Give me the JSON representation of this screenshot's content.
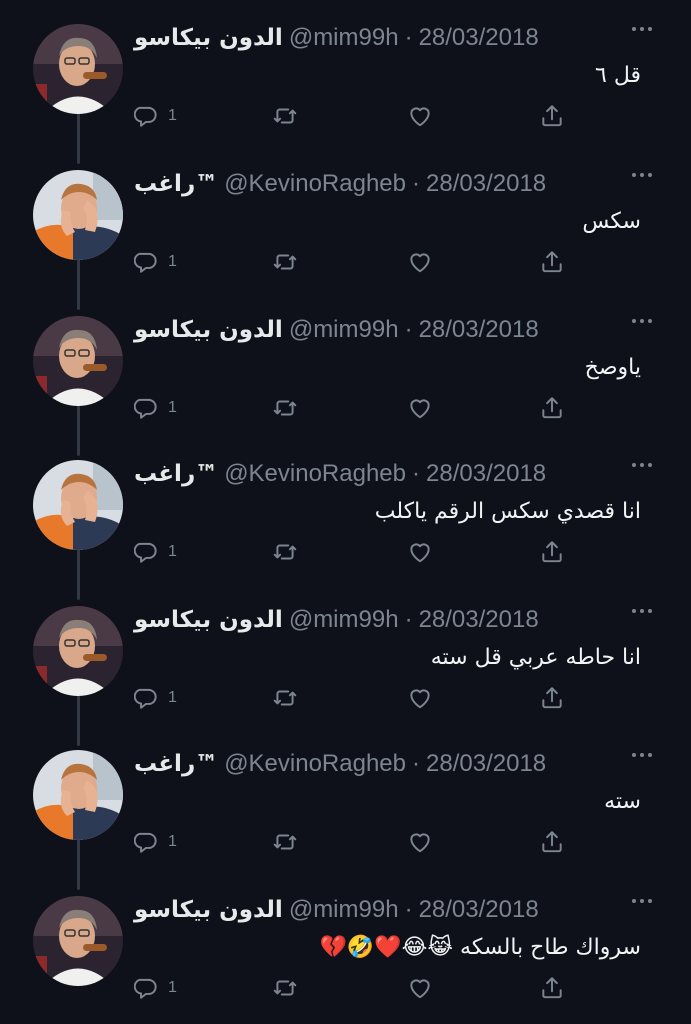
{
  "tweets": [
    {
      "author": "picasso",
      "display_name": "الدون بيكاسو",
      "handle": "@mim99h",
      "separator": "·",
      "date": "28/03/2018",
      "text": "قل ٦",
      "reply_count": "1"
    },
    {
      "author": "ragheb",
      "display_name": "راغب™",
      "handle": "@KevinoRagheb",
      "separator": "·",
      "date": "28/03/2018",
      "text": "سكس",
      "reply_count": "1"
    },
    {
      "author": "picasso",
      "display_name": "الدون بيكاسو",
      "handle": "@mim99h",
      "separator": "·",
      "date": "28/03/2018",
      "text": "ياوصخ",
      "reply_count": "1"
    },
    {
      "author": "ragheb",
      "display_name": "راغب™",
      "handle": "@KevinoRagheb",
      "separator": "·",
      "date": "28/03/2018",
      "text": "انا قصدي سكس الرقم ياكلب",
      "reply_count": "1"
    },
    {
      "author": "picasso",
      "display_name": "الدون بيكاسو",
      "handle": "@mim99h",
      "separator": "·",
      "date": "28/03/2018",
      "text": "انا حاطه عربي قل سته",
      "reply_count": "1"
    },
    {
      "author": "ragheb",
      "display_name": "راغب™",
      "handle": "@KevinoRagheb",
      "separator": "·",
      "date": "28/03/2018",
      "text": "سته",
      "reply_count": "1"
    },
    {
      "author": "picasso",
      "display_name": "الدون بيكاسو",
      "handle": "@mim99h",
      "separator": "·",
      "date": "28/03/2018",
      "text": "سرواك طاح بالسكه 😹😂❤️🤣💔",
      "reply_count": "1"
    }
  ],
  "icons": {
    "reply": "reply-icon",
    "retweet": "retweet-icon",
    "like": "heart-icon",
    "share": "share-icon",
    "more": "more-icon"
  },
  "colors": {
    "background": "#0e1119",
    "text": "#e7e9ea",
    "muted": "#7c8590",
    "thread_line": "#333845"
  }
}
